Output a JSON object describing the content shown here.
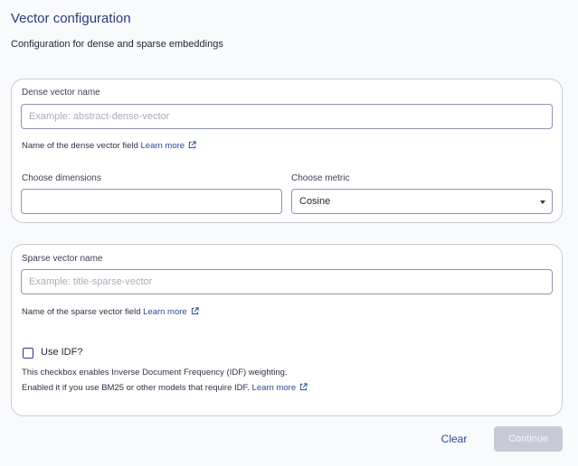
{
  "page": {
    "title": "Vector configuration",
    "subtitle": "Configuration for dense and sparse embeddings"
  },
  "dense": {
    "name_label": "Dense vector name",
    "name_placeholder": "Example: abstract-dense-vector",
    "name_value": "",
    "helper_text": "Name of the dense vector field",
    "learn_more": "Learn more",
    "dimensions_label": "Choose dimensions",
    "dimensions_value": "",
    "metric_label": "Choose metric",
    "metric_value": "Cosine"
  },
  "sparse": {
    "name_label": "Sparse vector name",
    "name_placeholder": "Example: title-sparse-vector",
    "name_value": "",
    "helper_text": "Name of the sparse vector field",
    "learn_more": "Learn more",
    "use_idf_label": "Use IDF?",
    "use_idf_checked": false,
    "idf_desc_line1": "This checkbox enables Inverse Document Frequency (IDF) weighting.",
    "idf_desc_line2": "Enabled it if you use BM25 or other models that require IDF.",
    "idf_learn_more": "Learn more"
  },
  "actions": {
    "clear_label": "Clear",
    "continue_label": "Continue",
    "continue_disabled": true
  },
  "icons": {
    "external_link": "external-link-icon",
    "dropdown": "caret-down-icon"
  },
  "colors": {
    "accent": "#2b4a9a",
    "title": "#2b3a7a",
    "border": "#c9ccd6",
    "input_border": "#8e95b3",
    "disabled_button": "#c8cbd5"
  }
}
